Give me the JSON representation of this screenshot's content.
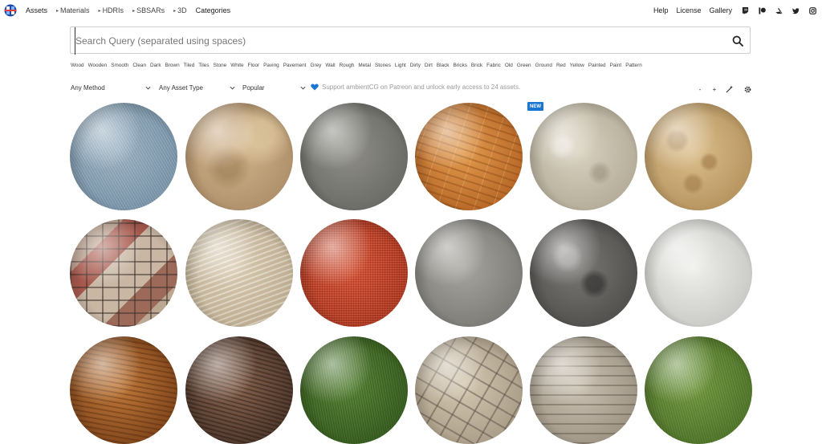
{
  "nav": {
    "left": [
      {
        "label": "Assets",
        "caret": false
      },
      {
        "label": "Materials",
        "caret": true
      },
      {
        "label": "HDRIs",
        "caret": true
      },
      {
        "label": "SBSARs",
        "caret": true
      },
      {
        "label": "3D",
        "caret": true
      },
      {
        "label": "Categories",
        "caret": false
      }
    ],
    "right": [
      "Help",
      "License",
      "Gallery"
    ],
    "social_icons": [
      "twitch-icon",
      "patreon-icon",
      "artstation-icon",
      "twitter-icon",
      "instagram-icon"
    ]
  },
  "search": {
    "placeholder": "Search Query (separated using spaces)",
    "value": ""
  },
  "tags": [
    "Wood",
    "Wooden",
    "Smooth",
    "Clean",
    "Dark",
    "Brown",
    "Tiled",
    "Tiles",
    "Stone",
    "White",
    "Floor",
    "Paving",
    "Pavement",
    "Grey",
    "Wall",
    "Rough",
    "Metal",
    "Stones",
    "Light",
    "Dirty",
    "Dirt",
    "Black",
    "Bricks",
    "Brick",
    "Fabric",
    "Old",
    "Green",
    "Ground",
    "Red",
    "Yellow",
    "Painted",
    "Paint",
    "Pattern"
  ],
  "filters": {
    "method": "Any Method",
    "asset_type": "Any Asset Type",
    "sort": "Popular"
  },
  "patreon_notice": "Support ambientCG on Patreon and unlock early access to 24 assets.",
  "tools": {
    "zoom_out": "-",
    "zoom_in": "+"
  },
  "badge_new": "NEW",
  "colors": {
    "badge": "#1b75d3",
    "heart": "#1b75d3"
  },
  "assets": [
    {
      "material": "m-denim"
    },
    {
      "material": "m-plaster"
    },
    {
      "material": "m-concrete"
    },
    {
      "material": "m-wood-floor"
    },
    {
      "material": "m-stucco",
      "new": true
    },
    {
      "material": "m-sand-pits"
    },
    {
      "material": "m-brick-stone"
    },
    {
      "material": "m-sand-dunes"
    },
    {
      "material": "m-fabric-red"
    },
    {
      "material": "m-smooth-concrete"
    },
    {
      "material": "m-rock"
    },
    {
      "material": "m-white-plaster"
    },
    {
      "material": "m-wood-warm"
    },
    {
      "material": "m-wood-dark"
    },
    {
      "material": "m-grass"
    },
    {
      "material": "m-cobble"
    },
    {
      "material": "m-stone-rings"
    },
    {
      "material": "m-grass-light"
    }
  ]
}
